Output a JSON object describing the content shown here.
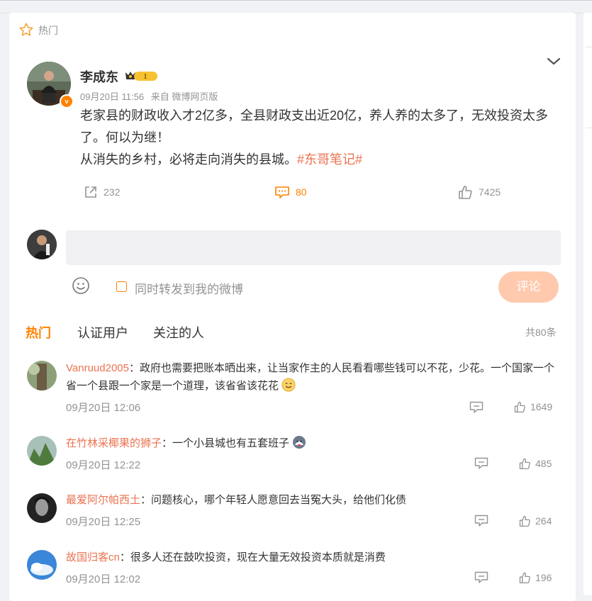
{
  "section_label": "热门",
  "post": {
    "username": "李成东",
    "vip_level": "1",
    "verified_badge": "v",
    "time": "09月20日 11:56",
    "source": "来自 微博网页版",
    "text_line1": "老家县的财政收入才2亿多，全县财政支出近20亿，养人养的太多了，无效投资太多",
    "text_line2": "了。何以为继！",
    "text_line3": "从消失的乡村，必将走向消失的县城。",
    "hashtag": "#东哥笔记#",
    "reposts": "232",
    "comments": "80",
    "likes": "7425"
  },
  "composer": {
    "placeholder": "",
    "repost_label": "同时转发到我的微博",
    "submit_label": "评论"
  },
  "comment_tabs": [
    "热门",
    "认证用户",
    "关注的人"
  ],
  "comment_total": "共80条",
  "comments": [
    {
      "user": "Vanruud2005",
      "sep": "：",
      "text_line1": "政府也需要把账本晒出来，让当家作主的人民看看哪些钱可以不花，少花。一个国家一个",
      "text_line2": "省一个县跟一个家是一个道理，该省省该花花",
      "time": "09月20日 12:06",
      "likes": "1649"
    },
    {
      "user": "在竹林采椰果的狮子",
      "sep": "：",
      "text_line1": "一个小县城也有五套班子",
      "time": "09月20日 12:22",
      "likes": "485"
    },
    {
      "user": "最爱阿尔帕西土",
      "sep": "：",
      "text_line1": "问题核心，哪个年轻人愿意回去当冤大头，给他们化债",
      "time": "09月20日 12:25",
      "likes": "264"
    },
    {
      "user": "故国归客cn",
      "sep": "：",
      "text_line1": "很多人还在鼓吹投资，现在大量无效投资本质就是消费",
      "time": "09月20日 12:02",
      "likes": "196"
    }
  ],
  "colors": {
    "accent": "#ff8200",
    "link": "#eb7350",
    "muted": "#939393",
    "submit_disabled": "#ffc9ad"
  }
}
